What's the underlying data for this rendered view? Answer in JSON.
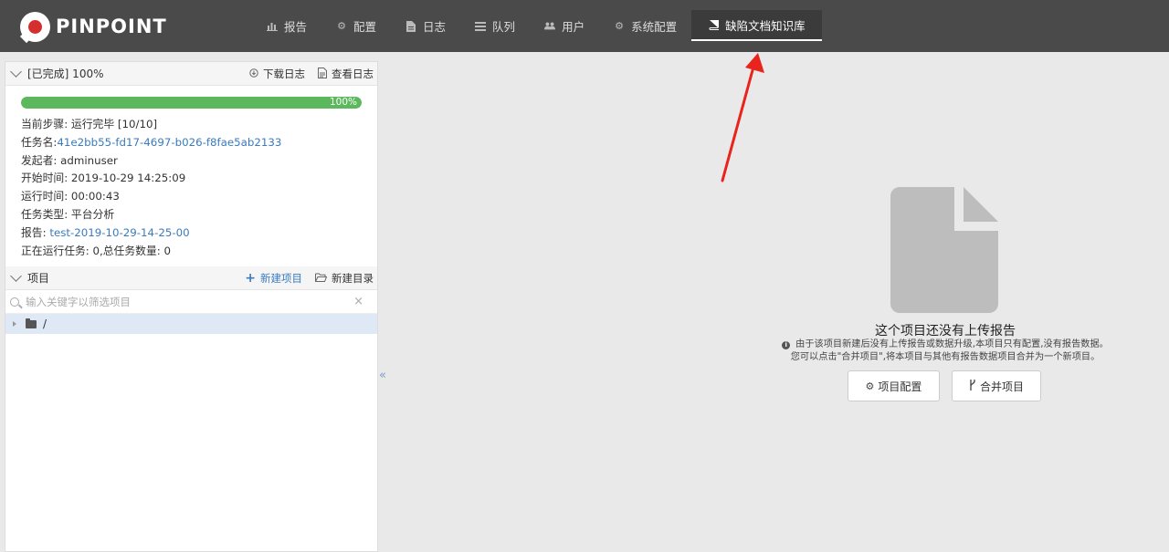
{
  "brand": {
    "name": "PINPOINT"
  },
  "nav": [
    {
      "label": "报告",
      "icon": "bar-chart-icon"
    },
    {
      "label": "配置",
      "icon": "gear-icon"
    },
    {
      "label": "日志",
      "icon": "file-icon"
    },
    {
      "label": "队列",
      "icon": "list-icon"
    },
    {
      "label": "用户",
      "icon": "users-icon"
    },
    {
      "label": "系统配置",
      "icon": "gear-icon"
    },
    {
      "label": "缺陷文档知识库",
      "icon": "book-icon",
      "active": true
    }
  ],
  "task": {
    "header": "[已完成] 100%",
    "download_log": "下载日志",
    "view_log": "查看日志",
    "progress_percent": 100,
    "progress_label": "100%",
    "rows": {
      "step_label": "当前步骤: ",
      "step_value": "运行完毕 [10/10]",
      "name_label": "任务名:",
      "name_value": "41e2bb55-fd17-4697-b026-f8fae5ab2133",
      "initiator_label": "发起者: ",
      "initiator_value": "adminuser",
      "start_label": "开始时间: ",
      "start_value": "2019-10-29 14:25:09",
      "runtime_label": "运行时间: ",
      "runtime_value": "00:00:43",
      "type_label": "任务类型: ",
      "type_value": "平台分析",
      "report_label": "报告: ",
      "report_value": "test-2019-10-29-14-25-00",
      "running_text": "正在运行任务: 0,总任务数量: 0"
    }
  },
  "projects": {
    "header": "项目",
    "new_project": "新建项目",
    "new_folder": "新建目录",
    "filter_placeholder": "输入关键字以筛选项目",
    "clear": "×",
    "root": "/"
  },
  "collapse": "«",
  "empty_state": {
    "title": "这个项目还没有上传报告",
    "desc_line1": "由于该项目新建后没有上传报告或数据升级,本项目只有配置,没有报告数据。",
    "desc_line2": "您可以点击\"合并项目\",将本项目与其他有报告数据项目合并为一个新项目。",
    "config_button": "项目配置",
    "merge_button": "合并项目"
  },
  "colors": {
    "topbar": "#4a4a4a",
    "progress": "#5cb85c",
    "link": "#3a7bbf",
    "arrow": "#e8241c"
  }
}
